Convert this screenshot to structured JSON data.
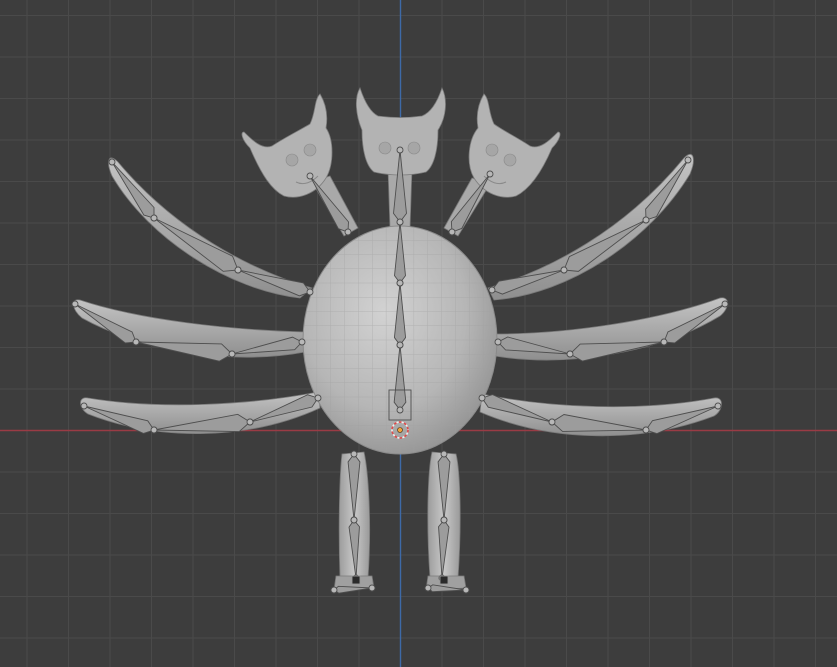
{
  "viewport": {
    "view": "front-orthographic",
    "background_color": "#3d3d3d",
    "grid_color": "#4a4a4a",
    "x_axis_color": "#9a3b45",
    "z_axis_color": "#3e6aa8",
    "mesh_color": "#b4b4b4",
    "bone_color": "#9a9a9a"
  },
  "scene": {
    "object": "three-headed-crab-creature",
    "armature": "bone-chain-skeleton",
    "cursor": "3d-cursor-at-origin",
    "origin": "object-origin-point"
  }
}
